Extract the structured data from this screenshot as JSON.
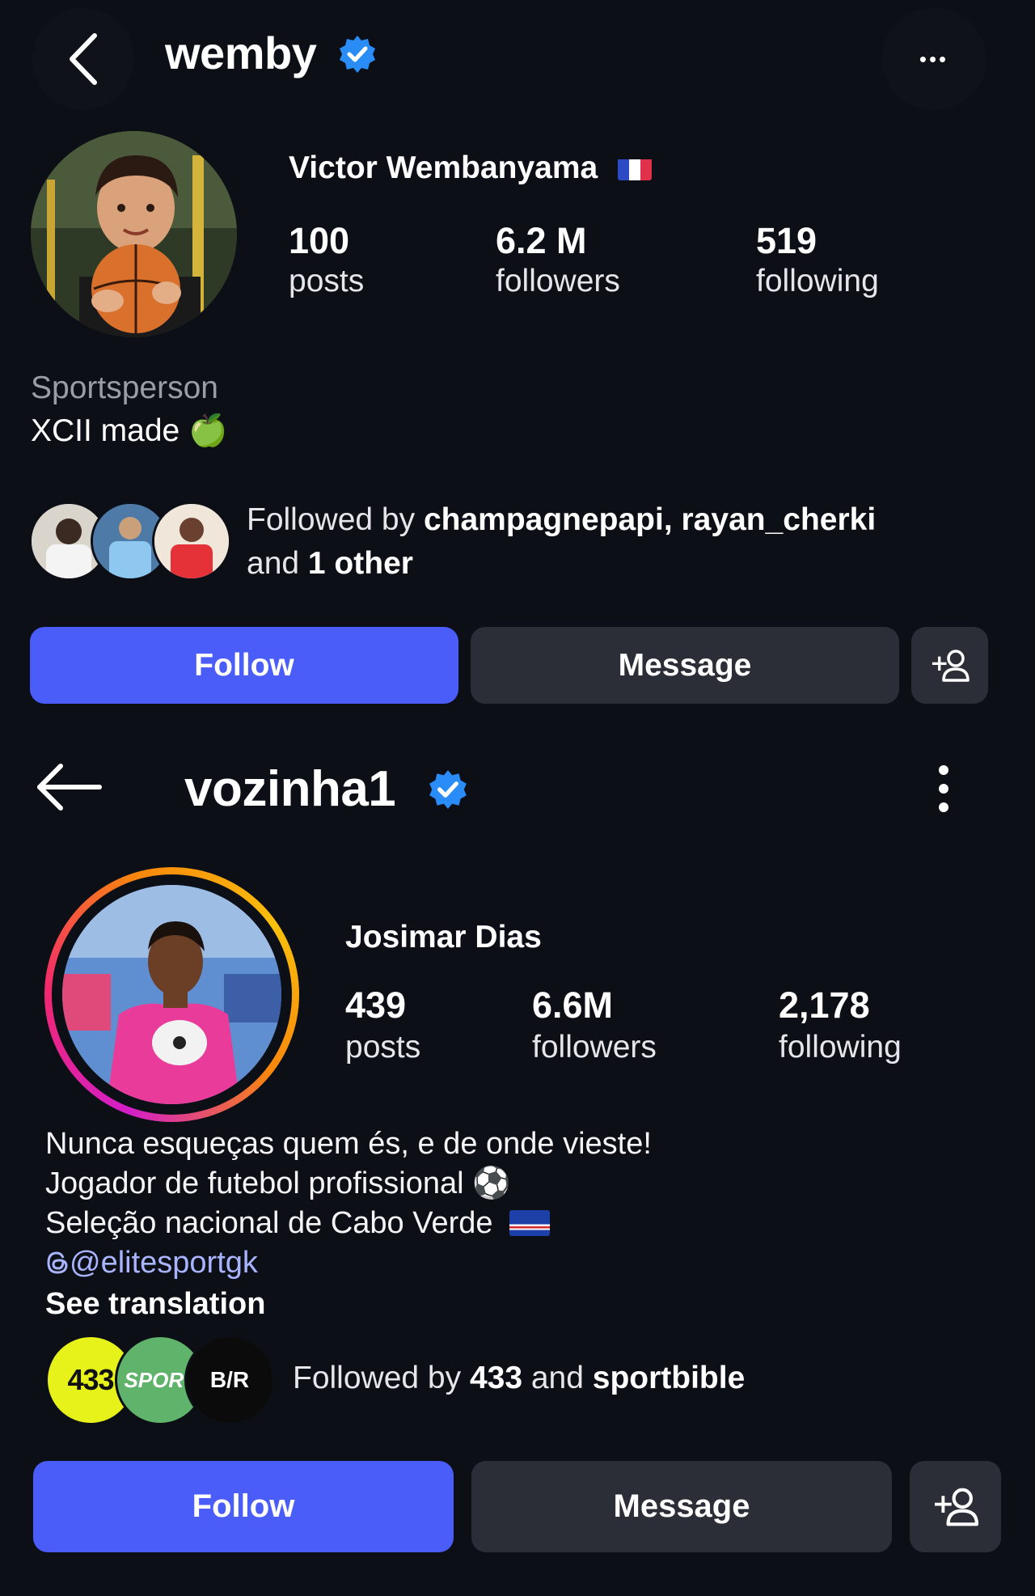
{
  "profile1": {
    "username": "wemby",
    "display_name": "Victor Wembanyama",
    "flag": "🇫🇷",
    "stats": [
      {
        "value": "100",
        "label": "posts"
      },
      {
        "value": "6.2 M",
        "label": "followers"
      },
      {
        "value": "519",
        "label": "following"
      }
    ],
    "category": "Sportsperson",
    "bio": "XCII made",
    "bio_emoji": "🍏",
    "followed_by_prefix": "Followed by ",
    "followed_by_names": "champagnepapi, rayan_cherki",
    "followed_by_and": "and ",
    "followed_by_other": "1 other",
    "follow_label": "Follow",
    "message_label": "Message",
    "more_label": "•••"
  },
  "profile2": {
    "username": "vozinha1",
    "display_name": "Josimar Dias",
    "stats": [
      {
        "value": "439",
        "label": "posts"
      },
      {
        "value": "6.6M",
        "label": "followers"
      },
      {
        "value": "2,178",
        "label": "following"
      }
    ],
    "bio_lines": [
      "Nunca esqueças quem és, e de onde vieste!",
      "Jogador de futebol profissional ⚽",
      "Seleção nacional de Cabo Verde"
    ],
    "link": "@elitesportgk",
    "see_translation": "See translation",
    "followed_by_prefix": "Followed by ",
    "followed_by_a": "433",
    "followed_by_and": " and ",
    "followed_by_b": "sportbible",
    "mini_avatars": [
      "433",
      "SPORT",
      "B/R"
    ],
    "follow_label": "Follow",
    "message_label": "Message"
  },
  "colors": {
    "background": "#0d0f17",
    "follow_button": "#4a5df9",
    "secondary_button": "#2b2e36",
    "verified": "#2a8cf7",
    "link": "#a9b4ff",
    "story_ring_start": "#f9c00c",
    "story_ring_end": "#d31ec9"
  }
}
